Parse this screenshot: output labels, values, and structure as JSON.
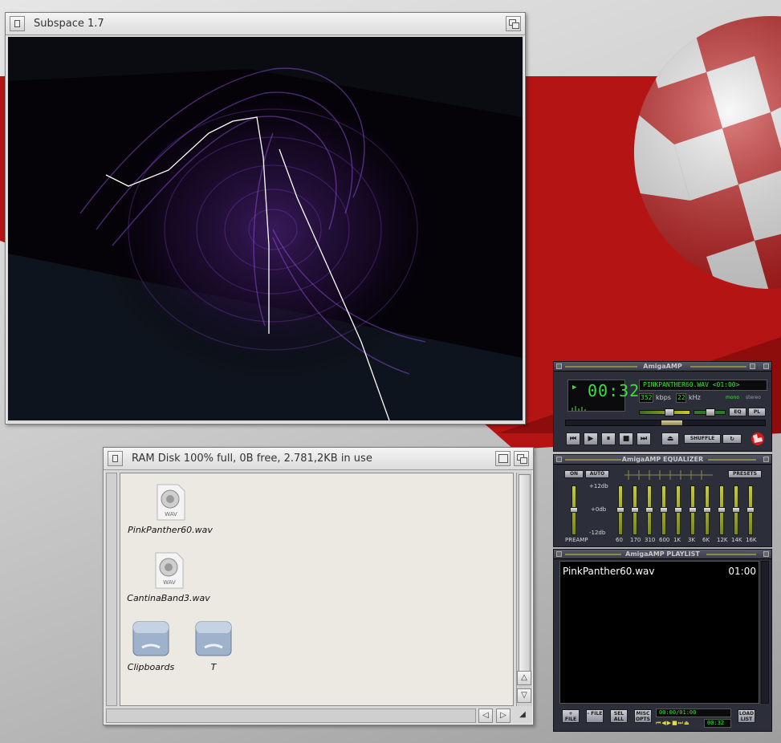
{
  "subspace": {
    "title": "Subspace 1.7"
  },
  "ramdisk": {
    "title": "RAM Disk  100% full, 0B free, 2.781,2KB in use",
    "icons": [
      {
        "label": "PinkPanther60.wav",
        "badge": "WAV",
        "icon": "wav-file-icon"
      },
      {
        "label": "CantinaBand3.wav",
        "badge": "WAV",
        "icon": "wav-file-icon"
      },
      {
        "label": "Clipboards",
        "icon": "drawer-icon"
      },
      {
        "label": "T",
        "icon": "drawer-icon"
      }
    ]
  },
  "amp": {
    "title": "AmigaAMP",
    "time": "00:32",
    "track_display": "PINKPANTHER60.WAV <01:00>",
    "kbps_value": "352",
    "kbps_label": "kbps",
    "khz_value": "22",
    "khz_label": "kHz",
    "mono_label": "mono",
    "stereo_label": "stereo",
    "eq_button": "EQ",
    "pl_button": "PL",
    "shuffle_button": "SHUFFLE",
    "volume_level": 0.6,
    "balance_level": 0.5,
    "seek_level": 0.53
  },
  "equalizer": {
    "title": "AmigaAMP EQUALIZER",
    "on_button": "ON",
    "auto_button": "AUTO",
    "presets_button": "PRESETS",
    "plus_db": "+12db",
    "zero_db": "+0db",
    "minus_db": "-12db",
    "preamp_label": "PREAMP",
    "bands": [
      "60",
      "170",
      "310",
      "600",
      "1K",
      "3K",
      "6K",
      "12K",
      "14K",
      "16K"
    ]
  },
  "playlist": {
    "title": "AmigaAMP PLAYLIST",
    "items": [
      {
        "name": "PinkPanther60.wav",
        "duration": "01:00"
      }
    ],
    "add_file": "+ FILE",
    "rem_file": "- FILE",
    "sel_all": "SEL ALL",
    "misc_opts": "MISC OPTS",
    "load_list": "LOAD LIST",
    "time_readout": "00:00/01:00",
    "mini_time": "00:32"
  },
  "colors": {
    "desktop_red": "#b51414",
    "lcd_green": "#3ce03c",
    "amp_panel": "#2c2e3a",
    "visual_purple": "#7a3fc2"
  }
}
